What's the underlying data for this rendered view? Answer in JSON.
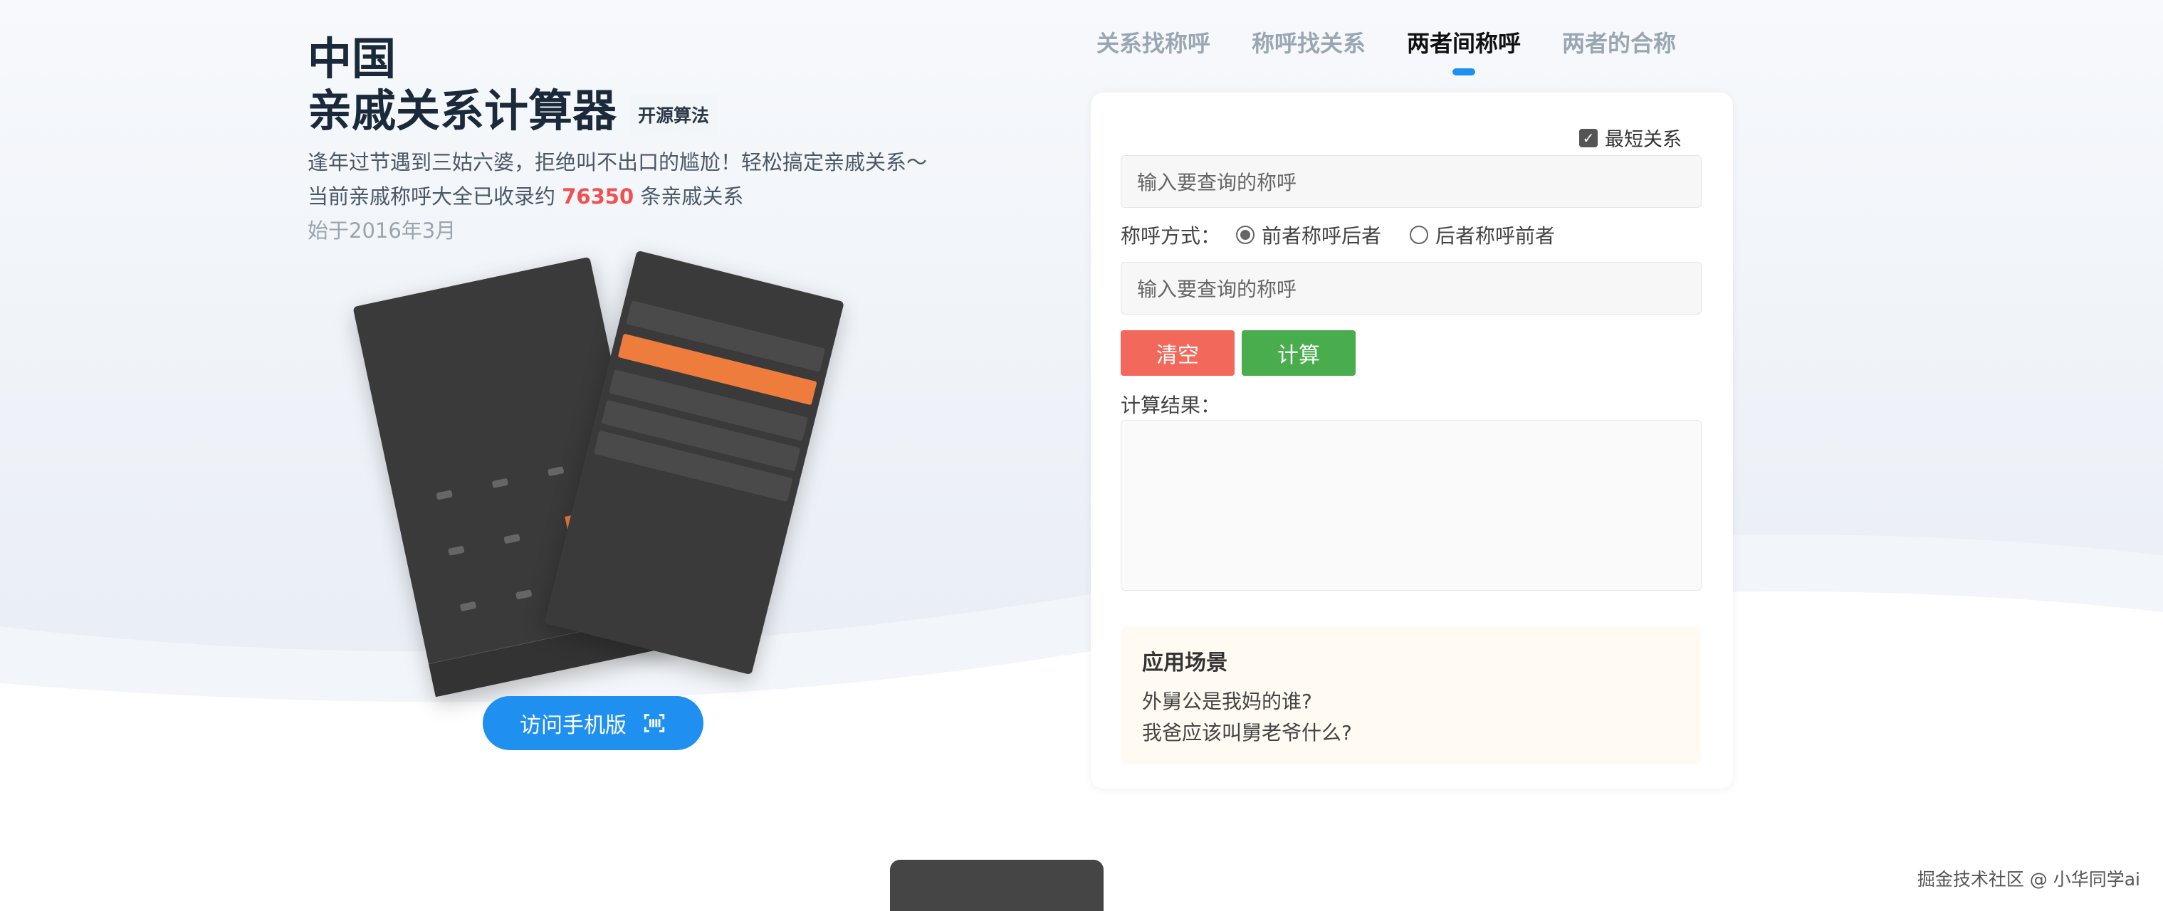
{
  "header": {
    "title_line1": "中国",
    "title_line2": "亲戚关系计算器",
    "badge": "开源算法"
  },
  "intro": {
    "line1": "逢年过节遇到三姑六婆，拒绝叫不出口的尴尬！轻松搞定亲戚关系～",
    "line2_prefix": "当前亲戚称呼大全已收录约",
    "count": "76350",
    "line2_suffix": "条亲戚关系",
    "since": "始于2016年3月"
  },
  "mobile": {
    "visit_label": "访问手机版",
    "qr_icon": "qrcode-scan-icon"
  },
  "nav": {
    "tabs": [
      {
        "label": "关系找称呼",
        "active": false
      },
      {
        "label": "称呼找关系",
        "active": false
      },
      {
        "label": "两者间称呼",
        "active": true
      },
      {
        "label": "两者的合称",
        "active": false
      }
    ]
  },
  "form": {
    "shortest_label": "最短关系",
    "shortest_checked": true,
    "input1_placeholder": "输入要查询的称呼",
    "mode_label": "称呼方式：",
    "mode_option1": "前者称呼后者",
    "mode_option2": "后者称呼前者",
    "mode_selected": 1,
    "input2_placeholder": "输入要查询的称呼",
    "clear_label": "清空",
    "calc_label": "计算",
    "result_label": "计算结果："
  },
  "scene": {
    "title": "应用场景",
    "q1": "外舅公是我妈的谁?",
    "q2": "我爸应该叫舅老爷什么?"
  },
  "watermark": "掘金技术社区 @ 小华同学ai",
  "colors": {
    "accent": "#1f8ff0",
    "clear": "#f2685a",
    "calc": "#49ad4e",
    "highlight": "#f0504f"
  }
}
